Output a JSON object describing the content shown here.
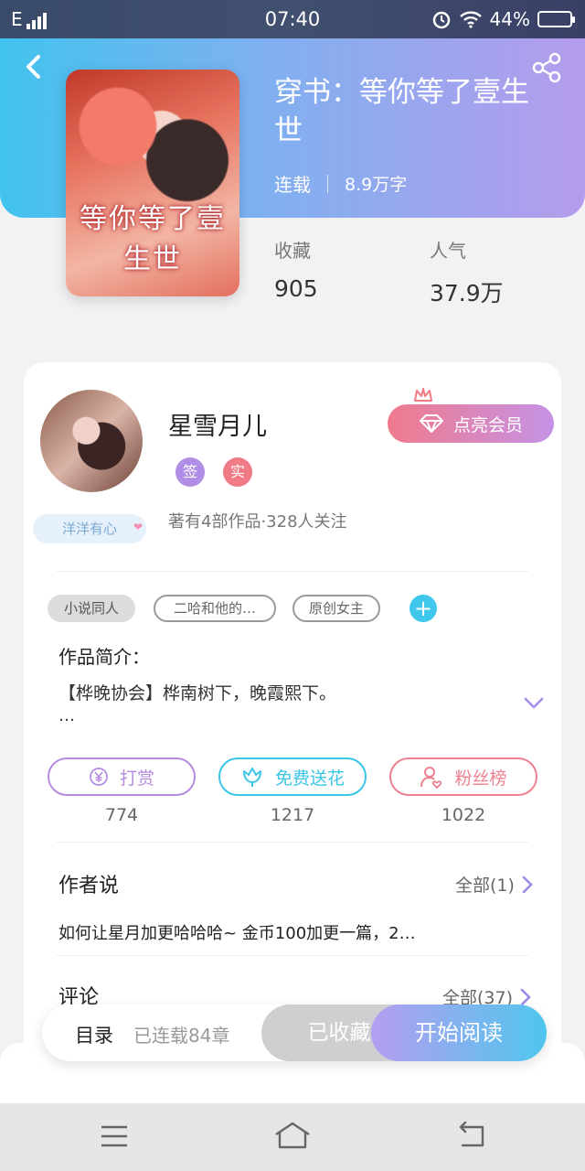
{
  "status_bar": {
    "network": "E",
    "time": "07:40",
    "battery": "44%"
  },
  "book": {
    "cover_text": "等你等了壹生世",
    "title": "穿书：等你等了壹生世",
    "status": "连载",
    "word_count": "8.9万字",
    "stats": [
      {
        "label": "收藏",
        "value": "905"
      },
      {
        "label": "人气",
        "value": "37.9万"
      }
    ]
  },
  "author": {
    "name": "星雪月儿",
    "badges": [
      {
        "label": "签",
        "color": "#b08ee6"
      },
      {
        "label": "实",
        "color": "#f07a86"
      }
    ],
    "fan_tag": "洋洋有心",
    "info": "著有4部作品·328人关注",
    "member_button": "点亮会员"
  },
  "tags": [
    "小说同人",
    "二哈和他的…",
    "原创女主"
  ],
  "intro": {
    "label": "作品简介：",
    "text": "【桦晚协会】桦南树下，晚霞熙下。",
    "more": "…"
  },
  "actions": [
    {
      "label": "打赏",
      "count": "774",
      "color": "#b48be0"
    },
    {
      "label": "免费送花",
      "count": "1217",
      "color": "#3cc6e6"
    },
    {
      "label": "粉丝榜",
      "count": "1022",
      "color": "#ee8090"
    }
  ],
  "author_says": {
    "title": "作者说",
    "all": "全部(1)",
    "note": "如何让星月加更哈哈哈~ 金币100加更一篇，2…"
  },
  "comments": {
    "title": "评论",
    "all": "全部(37)"
  },
  "bottom_bar": {
    "toc": "目录",
    "progress": "已连载84章",
    "collected": "已收藏",
    "read": "开始阅读"
  }
}
